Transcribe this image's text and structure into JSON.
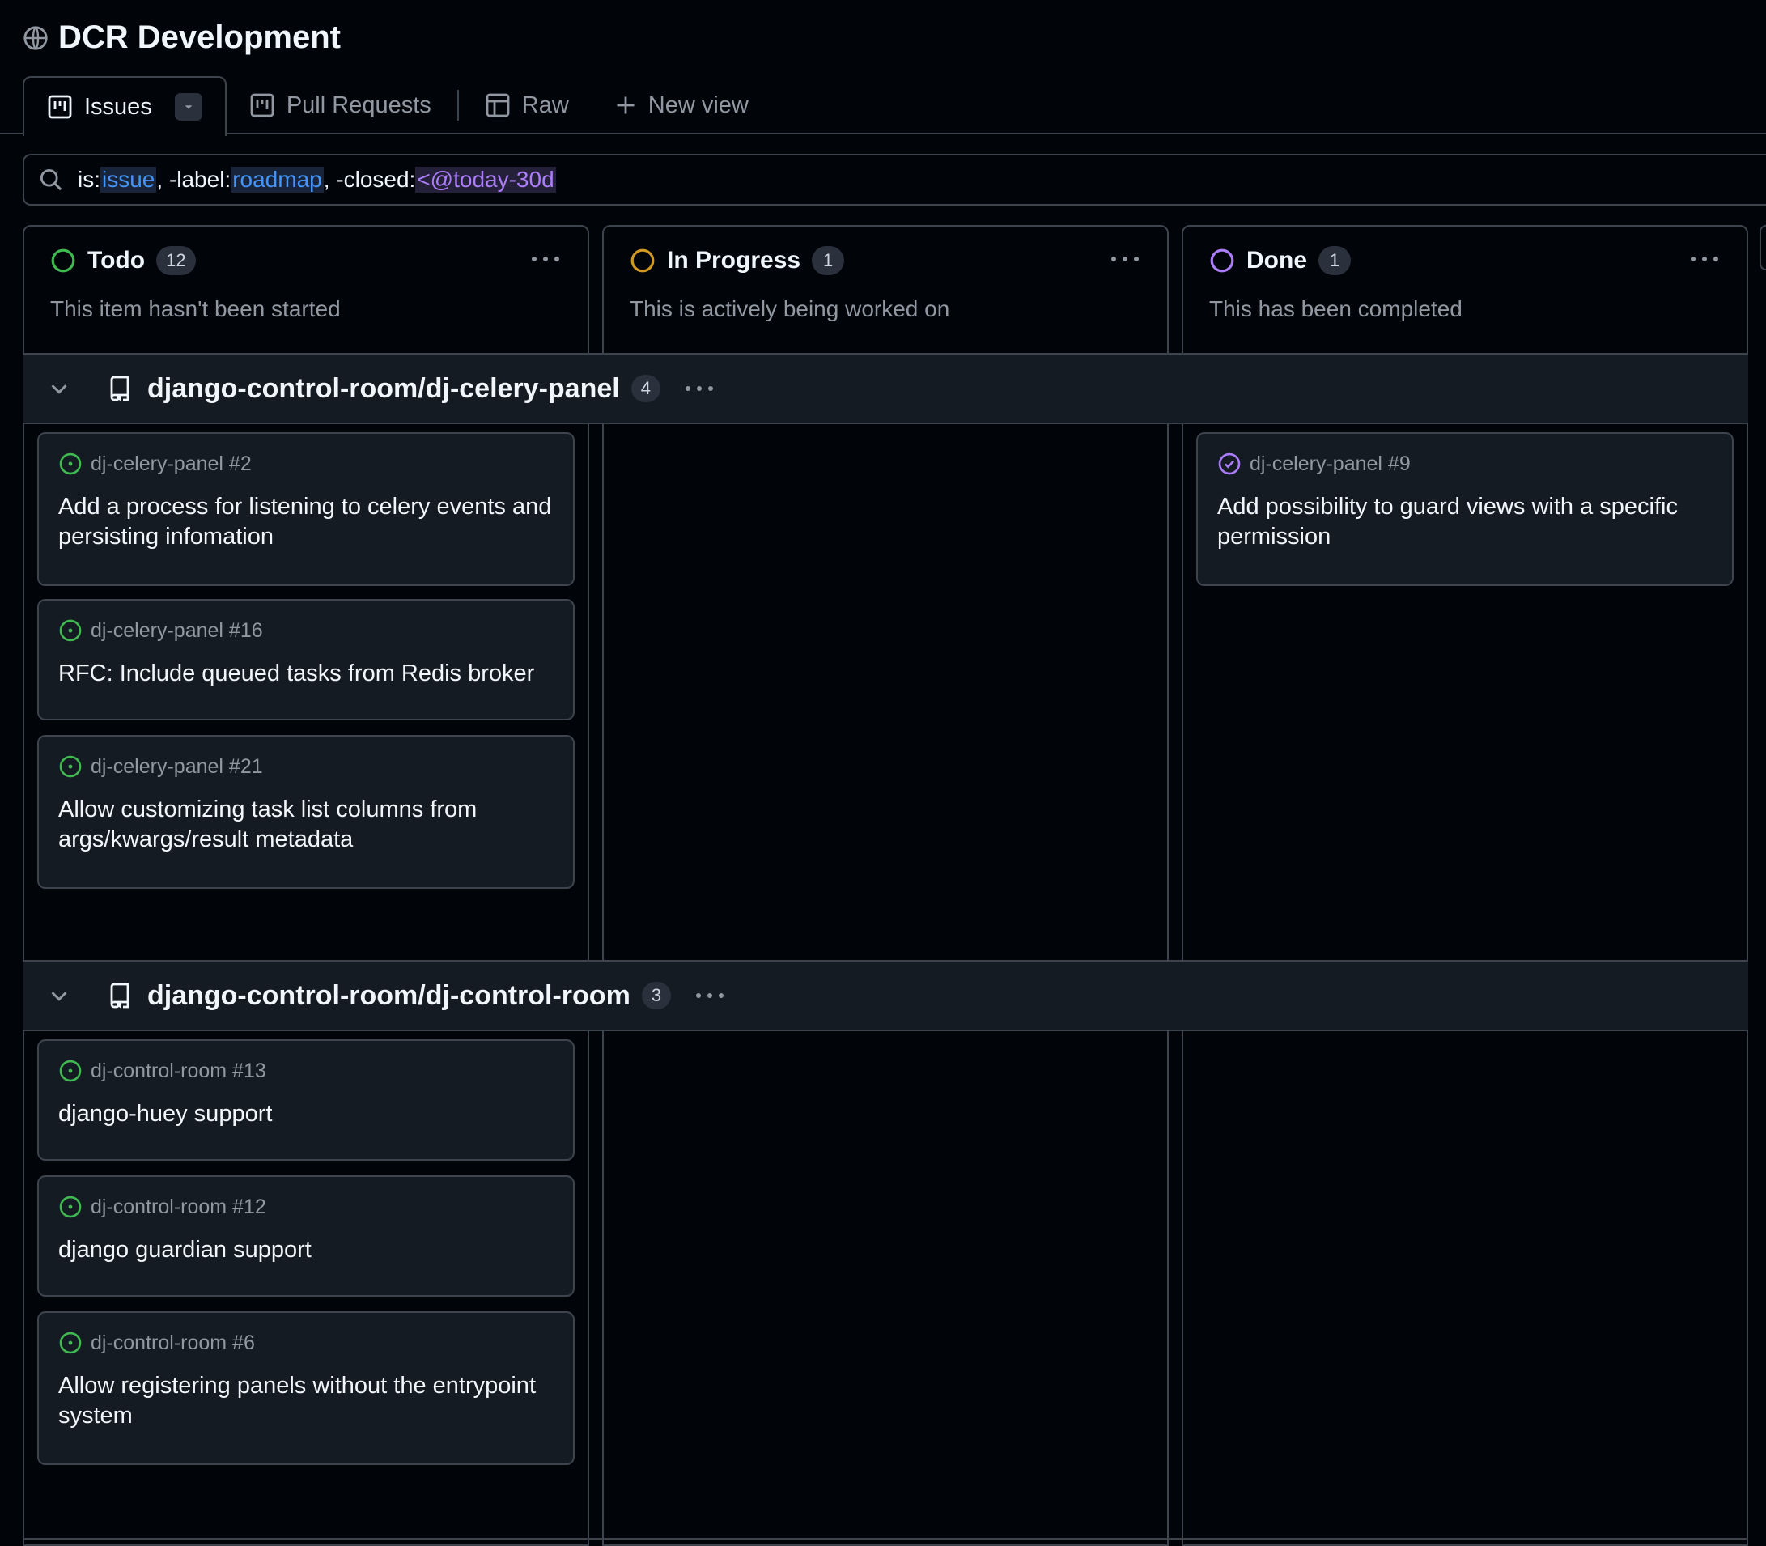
{
  "project": {
    "title": "DCR Development"
  },
  "tabs": [
    {
      "label": "Issues",
      "active": true
    },
    {
      "label": "Pull Requests",
      "active": false
    },
    {
      "label": "Raw",
      "active": false
    },
    {
      "label": "New view",
      "active": false
    }
  ],
  "filter": {
    "parts": [
      {
        "key": "is:",
        "value": "issue",
        "sep": ", "
      },
      {
        "key": "-label:",
        "value": "roadmap",
        "sep": ", "
      },
      {
        "key": "-closed:",
        "value": "<@today-30d",
        "sep": ""
      }
    ]
  },
  "columns": [
    {
      "name": "Todo",
      "count": "12",
      "description": "This item hasn't been started",
      "status_color": "#3fb950"
    },
    {
      "name": "In Progress",
      "count": "1",
      "description": "This is actively being worked on",
      "status_color": "#d29922"
    },
    {
      "name": "Done",
      "count": "1",
      "description": "This has been completed",
      "status_color": "#ab7df8"
    }
  ],
  "groups": [
    {
      "name": "django-control-room/dj-celery-panel",
      "count": "4",
      "todo": [
        {
          "ref": "dj-celery-panel #2",
          "title": "Add a process for listening to celery events and persisting infomation"
        },
        {
          "ref": "dj-celery-panel #16",
          "title": "RFC: Include queued tasks from Redis broker"
        },
        {
          "ref": "dj-celery-panel #21",
          "title": "Allow customizing task list columns from args/kwargs/result metadata"
        }
      ],
      "done": [
        {
          "ref": "dj-celery-panel #9",
          "title": "Add possibility to guard views with a specific permission"
        }
      ]
    },
    {
      "name": "django-control-room/dj-control-room",
      "count": "3",
      "todo": [
        {
          "ref": "dj-control-room #13",
          "title": "django-huey support"
        },
        {
          "ref": "dj-control-room #12",
          "title": "django guardian support"
        },
        {
          "ref": "dj-control-room #6",
          "title": "Allow registering panels without the entrypoint system"
        }
      ],
      "done": []
    }
  ],
  "colors": {
    "open_issue": "#3fb950",
    "closed_issue": "#ab7df8",
    "in_progress": "#d29922",
    "accent": "#4493f8"
  }
}
